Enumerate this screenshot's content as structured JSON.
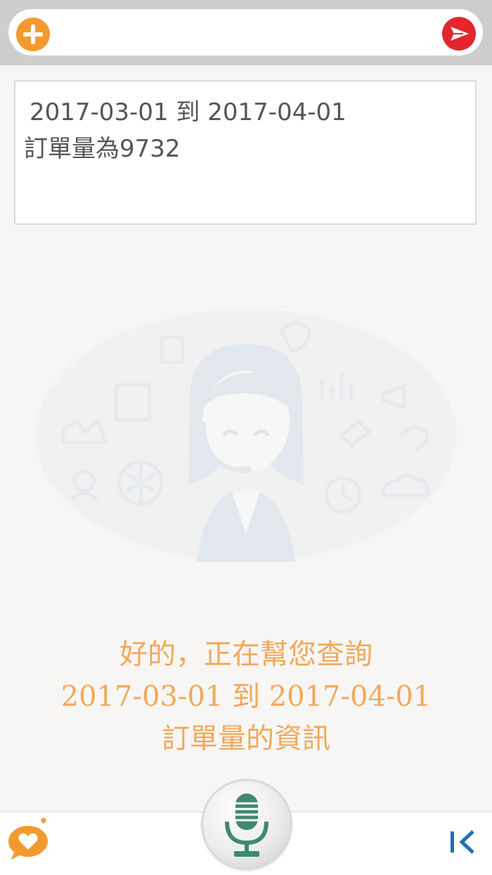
{
  "header": {
    "add_icon": "plus-circle-icon",
    "send_icon": "send-arrow-icon",
    "accent_add": "#f39a2e",
    "accent_send": "#e3262c"
  },
  "result": {
    "line1": " 2017-03-01 到 2017-04-01",
    "line2": "訂單量為9732"
  },
  "assistant": {
    "illustration_icon": "customer-service-agent-icon",
    "reply_lines": [
      "好的，正在幫您查詢",
      "2017-03-01 到 2017-04-01",
      "訂單量的資訊"
    ],
    "reply_color": "#f1a85a"
  },
  "footer": {
    "chat_icon": "heart-chat-icon",
    "mic_icon": "microphone-icon",
    "back_icon": "collapse-left-icon"
  }
}
